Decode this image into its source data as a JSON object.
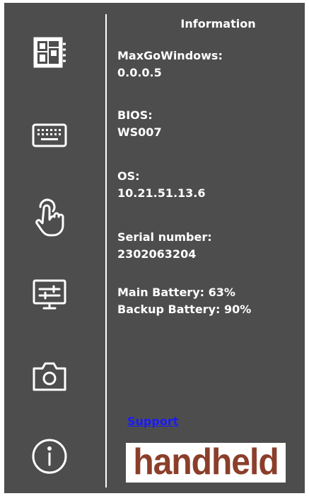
{
  "info": {
    "title": "Information",
    "maxgo_label": "MaxGoWindows:",
    "maxgo_value": "0.0.0.5",
    "bios_label": "BIOS:",
    "bios_value": "WS007",
    "os_label": "OS:",
    "os_value": "10.21.51.13.6",
    "serial_label": "Serial number:",
    "serial_value": "2302063204",
    "main_battery": "Main Battery: 63%",
    "backup_battery": "Backup Battery: 90%"
  },
  "support_link": "Support",
  "logo_text": "handheld",
  "nav_icons": [
    "device-layout-icon",
    "keyboard-icon",
    "touch-icon",
    "display-settings-icon",
    "camera-icon",
    "info-icon"
  ],
  "colors": {
    "panel_background": "#4d4d4d",
    "text": "#ffffff",
    "link": "#1a1aff",
    "logo_text": "#8b3e2a"
  }
}
